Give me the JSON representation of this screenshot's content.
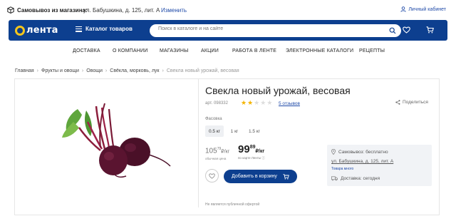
{
  "topbar": {
    "pickup_label": "Самовывоз из магазина:",
    "pickup_address": "ул. Бабушкина, д. 125, лит. А",
    "change_link": "Изменить",
    "account_label": "Личный кабинет"
  },
  "header": {
    "logo_text": "лента",
    "catalog_label": "Каталог товаров",
    "search_placeholder": "Поиск в каталоге и на сайте"
  },
  "nav": {
    "items": [
      "ДОСТАВКА",
      "О КОМПАНИИ",
      "МАГАЗИНЫ",
      "АКЦИИ",
      "РАБОТА В ЛЕНТЕ",
      "ЭЛЕКТРОННЫЕ КАТАЛОГИ",
      "РЕЦЕПТЫ"
    ]
  },
  "breadcrumb": {
    "items": [
      "Главная",
      "Фрукты и овощи",
      "Овощи",
      "Свёкла, морковь, лук"
    ],
    "current": "Свекла новый урожай, весовая"
  },
  "product": {
    "title": "Свекла новый урожай, весовая",
    "sku": "арт. 098332",
    "rating": 2,
    "rating_max": 5,
    "reviews": "5 отзывов",
    "share": "Поделиться",
    "pack_label": "Фасовка",
    "pack_options": [
      "0.5 кг",
      "1 кг",
      "1.5 кг"
    ],
    "pack_selected": "0.5 кг",
    "old_price_int": "105",
    "old_price_frac": "79",
    "old_price_unit": "₽/кг",
    "old_price_note": "обычная цена",
    "new_price_int": "99",
    "new_price_frac": "89",
    "new_price_unit": "₽/кг",
    "new_price_note": "по карте Ленты ⓘ",
    "cart_button": "Добавить в корзину",
    "offer_note": "Не является публичной офертой"
  },
  "delivery": {
    "pickup": "Самовывоз: бесплатно",
    "address": "ул. Бабушкина, д. 125, лит. А",
    "stock": "Товара много",
    "delivery": "Доставка: сегодня"
  },
  "colors": {
    "brand_blue": "#0d3f8f",
    "brand_yellow": "#f4c51d",
    "link_blue": "#1f4aa8",
    "star": "#f4b400"
  }
}
